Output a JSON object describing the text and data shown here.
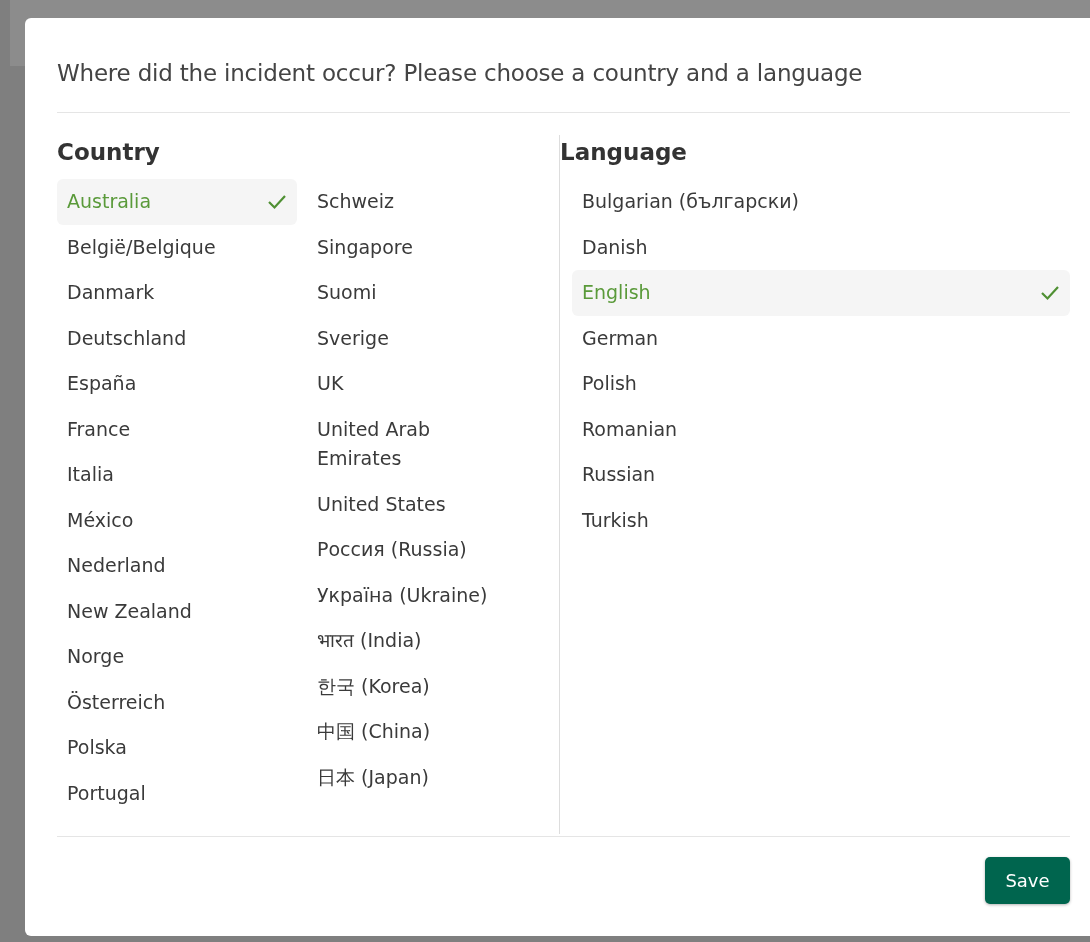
{
  "dialog": {
    "title": "Where did the incident occur? Please choose a country and a language",
    "country": {
      "heading": "Country",
      "columns": [
        [
          {
            "label": "Australia",
            "selected": true
          },
          {
            "label": "België/Belgique",
            "selected": false
          },
          {
            "label": "Danmark",
            "selected": false
          },
          {
            "label": "Deutschland",
            "selected": false
          },
          {
            "label": "España",
            "selected": false
          },
          {
            "label": "France",
            "selected": false
          },
          {
            "label": "Italia",
            "selected": false
          },
          {
            "label": "México",
            "selected": false
          },
          {
            "label": "Nederland",
            "selected": false
          },
          {
            "label": "New Zealand",
            "selected": false
          },
          {
            "label": "Norge",
            "selected": false
          },
          {
            "label": "Österreich",
            "selected": false
          },
          {
            "label": "Polska",
            "selected": false
          },
          {
            "label": "Portugal",
            "selected": false
          }
        ],
        [
          {
            "label": "Schweiz",
            "selected": false
          },
          {
            "label": "Singapore",
            "selected": false
          },
          {
            "label": "Suomi",
            "selected": false
          },
          {
            "label": "Sverige",
            "selected": false
          },
          {
            "label": "UK",
            "selected": false
          },
          {
            "label": "United Arab Emirates",
            "selected": false
          },
          {
            "label": "United States",
            "selected": false
          },
          {
            "label": "Россия (Russia)",
            "selected": false
          },
          {
            "label": "Україна (Ukraine)",
            "selected": false
          },
          {
            "label": "भारत (India)",
            "selected": false
          },
          {
            "label": "한국 (Korea)",
            "selected": false
          },
          {
            "label": "中国 (China)",
            "selected": false
          },
          {
            "label": "日本 (Japan)",
            "selected": false
          }
        ]
      ]
    },
    "language": {
      "heading": "Language",
      "items": [
        {
          "label": "Bulgarian (български)",
          "selected": false
        },
        {
          "label": "Danish",
          "selected": false
        },
        {
          "label": "English",
          "selected": true
        },
        {
          "label": "German",
          "selected": false
        },
        {
          "label": "Polish",
          "selected": false
        },
        {
          "label": "Romanian",
          "selected": false
        },
        {
          "label": "Russian",
          "selected": false
        },
        {
          "label": "Turkish",
          "selected": false
        }
      ]
    },
    "save_button": "Save"
  }
}
